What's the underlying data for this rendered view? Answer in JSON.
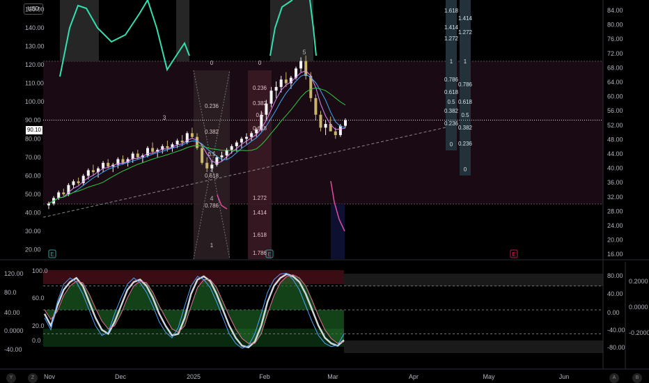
{
  "header": {
    "currency": "USD",
    "current_price": "90.10"
  },
  "corner_buttons": {
    "left_y": "Y",
    "left_z": "Z",
    "right_a": "A",
    "right_b": "B"
  },
  "chart_data": [
    {
      "type": "candlestick",
      "panel": "main",
      "y_left_ticks": [
        "150.00",
        "140.00",
        "130.00",
        "120.00",
        "110.00",
        "100.00",
        "90.00",
        "80.00",
        "70.00",
        "60.00",
        "50.00",
        "40.00",
        "30.00",
        "20.00"
      ],
      "y_right_ticks": [
        "84.00",
        "80.00",
        "76.00",
        "72.00",
        "68.00",
        "64.00",
        "60.00",
        "56.00",
        "52.00",
        "48.00",
        "44.00",
        "40.00",
        "36.00",
        "32.00",
        "28.00",
        "24.00",
        "20.00",
        "16.00"
      ],
      "ylim_left": [
        15,
        155
      ],
      "x_labels": [
        "Nov",
        "Dec",
        "2025",
        "Feb",
        "Mar",
        "Apr",
        "May",
        "Jun"
      ],
      "wave_labels": [
        "3",
        "4",
        "5"
      ],
      "event_markers": [
        "E",
        "E",
        "E"
      ],
      "fib_left": [
        "0",
        "0.236",
        "0.382",
        "0.5",
        "0.618",
        "0.786",
        "1"
      ],
      "fib_mid": [
        "0",
        "0.236",
        "0.382",
        "0.5",
        "0.618",
        "1.272",
        "1.414",
        "1.618",
        "1.786"
      ],
      "fib_right_a": [
        "1.618",
        "1.414",
        "1.272",
        "1",
        "0.786",
        "0.618",
        "0.5",
        "0.382",
        "0.236",
        "0"
      ],
      "fib_right_b": [
        "1.414",
        "1.272",
        "1",
        "0.786",
        "0.618",
        "0.5",
        "0.382",
        "0.236",
        "0"
      ],
      "candles": [
        [
          44,
          46,
          42,
          45
        ],
        [
          45,
          49,
          44,
          48
        ],
        [
          48,
          52,
          47,
          51
        ],
        [
          51,
          53,
          49,
          50
        ],
        [
          50,
          56,
          49,
          55
        ],
        [
          55,
          58,
          53,
          57
        ],
        [
          57,
          59,
          55,
          56
        ],
        [
          56,
          61,
          55,
          60
        ],
        [
          60,
          64,
          58,
          63
        ],
        [
          63,
          66,
          60,
          62
        ],
        [
          62,
          65,
          59,
          64
        ],
        [
          64,
          68,
          62,
          67
        ],
        [
          67,
          69,
          64,
          65
        ],
        [
          65,
          67,
          62,
          66
        ],
        [
          66,
          70,
          64,
          69
        ],
        [
          69,
          71,
          66,
          67
        ],
        [
          67,
          70,
          65,
          69
        ],
        [
          69,
          73,
          67,
          72
        ],
        [
          72,
          74,
          69,
          70
        ],
        [
          70,
          72,
          67,
          71
        ],
        [
          71,
          76,
          70,
          75
        ],
        [
          75,
          78,
          72,
          73
        ],
        [
          73,
          75,
          70,
          74
        ],
        [
          74,
          77,
          72,
          76
        ],
        [
          76,
          79,
          73,
          75
        ],
        [
          75,
          78,
          73,
          77
        ],
        [
          77,
          80,
          75,
          79
        ],
        [
          79,
          82,
          76,
          78
        ],
        [
          78,
          84,
          77,
          83
        ],
        [
          83,
          86,
          80,
          81
        ],
        [
          81,
          83,
          74,
          75
        ],
        [
          75,
          77,
          66,
          67
        ],
        [
          67,
          70,
          62,
          64
        ],
        [
          64,
          68,
          62,
          66
        ],
        [
          66,
          71,
          65,
          70
        ],
        [
          70,
          73,
          68,
          71
        ],
        [
          71,
          75,
          69,
          74
        ],
        [
          74,
          77,
          72,
          76
        ],
        [
          76,
          79,
          73,
          78
        ],
        [
          78,
          81,
          75,
          80
        ],
        [
          80,
          83,
          77,
          81
        ],
        [
          81,
          84,
          79,
          83
        ],
        [
          83,
          86,
          81,
          85
        ],
        [
          85,
          95,
          84,
          93
        ],
        [
          93,
          101,
          90,
          99
        ],
        [
          99,
          108,
          97,
          106
        ],
        [
          106,
          111,
          102,
          108
        ],
        [
          108,
          114,
          105,
          112
        ],
        [
          112,
          116,
          108,
          110
        ],
        [
          110,
          114,
          107,
          113
        ],
        [
          113,
          119,
          112,
          118
        ],
        [
          118,
          124,
          116,
          122
        ],
        [
          122,
          125,
          112,
          114
        ],
        [
          114,
          116,
          100,
          102
        ],
        [
          102,
          104,
          90,
          93
        ],
        [
          93,
          95,
          84,
          86
        ],
        [
          86,
          90,
          82,
          88
        ],
        [
          88,
          92,
          85,
          84
        ],
        [
          84,
          86,
          80,
          82
        ],
        [
          82,
          88,
          81,
          87
        ],
        [
          87,
          91,
          86,
          90
        ]
      ]
    },
    {
      "type": "line",
      "panel": "oscillator",
      "y_left_ticks": [
        "120.00",
        "100.0",
        "80.0",
        "60.0",
        "40.00",
        "20.0",
        "0.0000",
        "0.0",
        "-40.00"
      ],
      "y_right_ticks": [
        "80.00",
        "40.00",
        "0.00",
        "-40.00",
        "-80.00"
      ],
      "y_right2_ticks": [
        "0.2000",
        "0.0000",
        "-0.2000"
      ],
      "ylim": [
        -5,
        105
      ],
      "levels": [
        80,
        50,
        20
      ],
      "series": [
        {
          "values": [
            45,
            30,
            55,
            75,
            85,
            90,
            80,
            60,
            40,
            25,
            20,
            35,
            55,
            75,
            85,
            88,
            80,
            65,
            45,
            30,
            18,
            20,
            40,
            70,
            88,
            92,
            86,
            70,
            50,
            30,
            15,
            5,
            3,
            10,
            30,
            60,
            80,
            90,
            95,
            92,
            85,
            70,
            50,
            30,
            15,
            8,
            5,
            12
          ]
        },
        {
          "values": [
            50,
            38,
            48,
            68,
            80,
            86,
            84,
            70,
            52,
            36,
            26,
            30,
            45,
            65,
            80,
            86,
            84,
            72,
            55,
            40,
            26,
            22,
            30,
            55,
            78,
            88,
            88,
            78,
            60,
            42,
            26,
            14,
            8,
            8,
            20,
            45,
            68,
            84,
            92,
            94,
            90,
            80,
            62,
            42,
            25,
            14,
            8,
            10
          ]
        },
        {
          "values": [
            40,
            25,
            60,
            82,
            90,
            85,
            70,
            50,
            30,
            18,
            22,
            45,
            65,
            82,
            90,
            84,
            72,
            55,
            35,
            22,
            15,
            28,
            55,
            80,
            92,
            88,
            78,
            60,
            40,
            20,
            8,
            2,
            5,
            20,
            45,
            72,
            88,
            95,
            96,
            88,
            75,
            55,
            35,
            18,
            8,
            4,
            6,
            20
          ]
        }
      ]
    }
  ]
}
